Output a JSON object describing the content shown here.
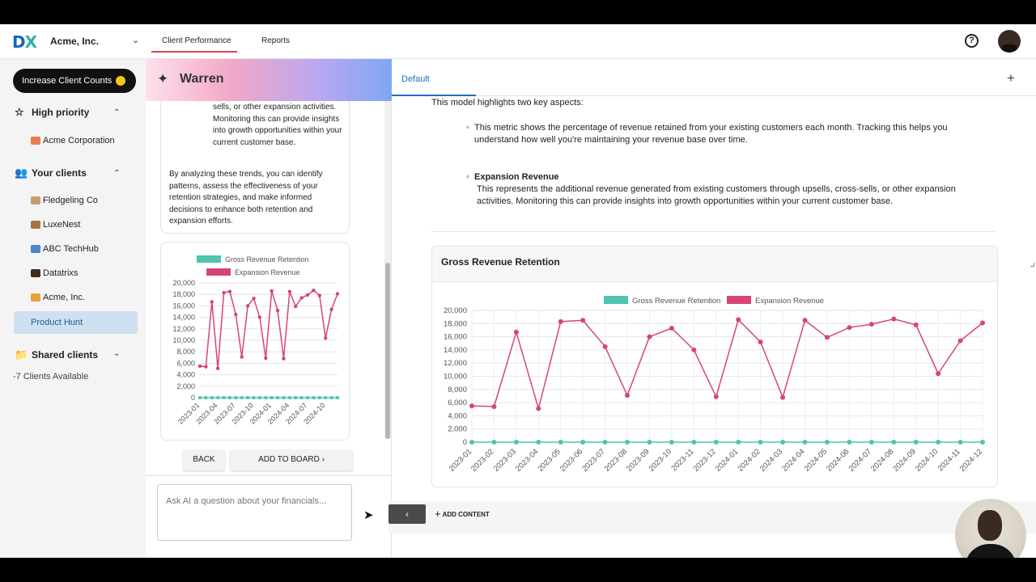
{
  "topbar": {
    "logo_d": "D",
    "logo_x": "X",
    "company": "Acme, Inc.",
    "tabs": [
      {
        "label": "Client Performance"
      },
      {
        "label": "Reports"
      }
    ]
  },
  "sidebar": {
    "goal_button": "Increase Client Counts",
    "high_priority": {
      "label": "High priority",
      "items": [
        {
          "label": "Acme Corporation"
        }
      ]
    },
    "your_clients": {
      "label": "Your clients",
      "items": [
        {
          "label": "Fledgeling Co"
        },
        {
          "label": "LuxeNest"
        },
        {
          "label": "ABC TechHub"
        },
        {
          "label": "Datatrixs"
        },
        {
          "label": "Acme, Inc."
        },
        {
          "label": "Product Hunt"
        }
      ]
    },
    "shared_clients": {
      "label": "Shared clients",
      "available": "-7 Clients Available"
    }
  },
  "chat": {
    "title": "Warren",
    "bullet_text": "sells, or other expansion activities. Monitoring this can provide insights into growth opportunities within your current customer base.",
    "paragraph": "By analyzing these trends, you can identify patterns, assess the effectiveness of your retention strategies, and make informed decisions to enhance both retention and expansion efforts.",
    "back_label": "BACK",
    "add_to_board_label": "ADD TO BOARD",
    "input_placeholder": "Ask AI a question about your financials..."
  },
  "main": {
    "tab": "Default",
    "intro": "This model highlights two key aspects:",
    "item1": "This metric shows the percentage of revenue retained from your existing customers each month. Tracking this helps you understand how well you're maintaining your revenue base over time.",
    "item2_head": "Expansion Revenue",
    "item2": "This represents the additional revenue generated from existing customers through upsells, cross-sells, or other expansion activities. Monitoring this can provide insights into growth opportunities within your current customer base.",
    "chart_title": "Gross Revenue Retention",
    "add_content": "ADD CONTENT"
  },
  "colors": {
    "gross_revenue_retention": "#4fc4b0",
    "expansion_revenue": "#d6457a",
    "accent": "#1f6fbf"
  },
  "chart_data": [
    {
      "type": "line",
      "title": "",
      "series": [
        {
          "name": "Gross Revenue Retention",
          "values": [
            0,
            0,
            0,
            0,
            0,
            0,
            0,
            0,
            0,
            0,
            0,
            0,
            0,
            0,
            0,
            0,
            0,
            0,
            0,
            0,
            0,
            0,
            0,
            0
          ]
        },
        {
          "name": "Expansion Revenue",
          "values": [
            5500,
            5400,
            16700,
            5100,
            18300,
            18500,
            14500,
            7100,
            16000,
            17300,
            14000,
            6900,
            18600,
            15200,
            6800,
            18500,
            15900,
            17400,
            17900,
            18700,
            17800,
            10400,
            15400,
            18100
          ]
        }
      ],
      "x": [
        "2023-01",
        "2023-02",
        "2023-03",
        "2023-04",
        "2023-05",
        "2023-06",
        "2023-07",
        "2023-08",
        "2023-09",
        "2023-10",
        "2023-11",
        "2023-12",
        "2024-01",
        "2024-02",
        "2024-03",
        "2024-04",
        "2024-05",
        "2024-06",
        "2024-07",
        "2024-08",
        "2024-09",
        "2024-10",
        "2024-11",
        "2024-12"
      ],
      "ylim": [
        0,
        20000
      ],
      "yticks": [
        "0",
        "2,000",
        "4,000",
        "6,000",
        "8,000",
        "10,000",
        "12,000",
        "14,000",
        "16,000",
        "18,000",
        "20,000"
      ],
      "xlabel": "",
      "ylabel": "",
      "grid": true,
      "legend": "top"
    },
    {
      "type": "line",
      "title": "Gross Revenue Retention",
      "series": [
        {
          "name": "Gross Revenue Retention",
          "values": [
            0,
            0,
            0,
            0,
            0,
            0,
            0,
            0,
            0,
            0,
            0,
            0,
            0,
            0,
            0,
            0,
            0,
            0,
            0,
            0,
            0,
            0,
            0,
            0
          ]
        },
        {
          "name": "Expansion Revenue",
          "values": [
            5500,
            5400,
            16700,
            5100,
            18300,
            18500,
            14500,
            7100,
            16000,
            17300,
            14000,
            6900,
            18600,
            15200,
            6800,
            18500,
            15900,
            17400,
            17900,
            18700,
            17800,
            10400,
            15400,
            18100
          ]
        }
      ],
      "x": [
        "2023-01",
        "2023-02",
        "2023-03",
        "2023-04",
        "2023-05",
        "2023-06",
        "2023-07",
        "2023-08",
        "2023-09",
        "2023-10",
        "2023-11",
        "2023-12",
        "2024-01",
        "2024-02",
        "2024-03",
        "2024-04",
        "2024-05",
        "2024-06",
        "2024-07",
        "2024-08",
        "2024-09",
        "2024-10",
        "2024-11",
        "2024-12"
      ],
      "ylim": [
        0,
        20000
      ],
      "yticks": [
        "0",
        "2,000",
        "4,000",
        "6,000",
        "8,000",
        "10,000",
        "12,000",
        "14,000",
        "16,000",
        "18,000",
        "20,000"
      ],
      "xlabel": "",
      "ylabel": "",
      "grid": true,
      "legend": "top"
    }
  ]
}
